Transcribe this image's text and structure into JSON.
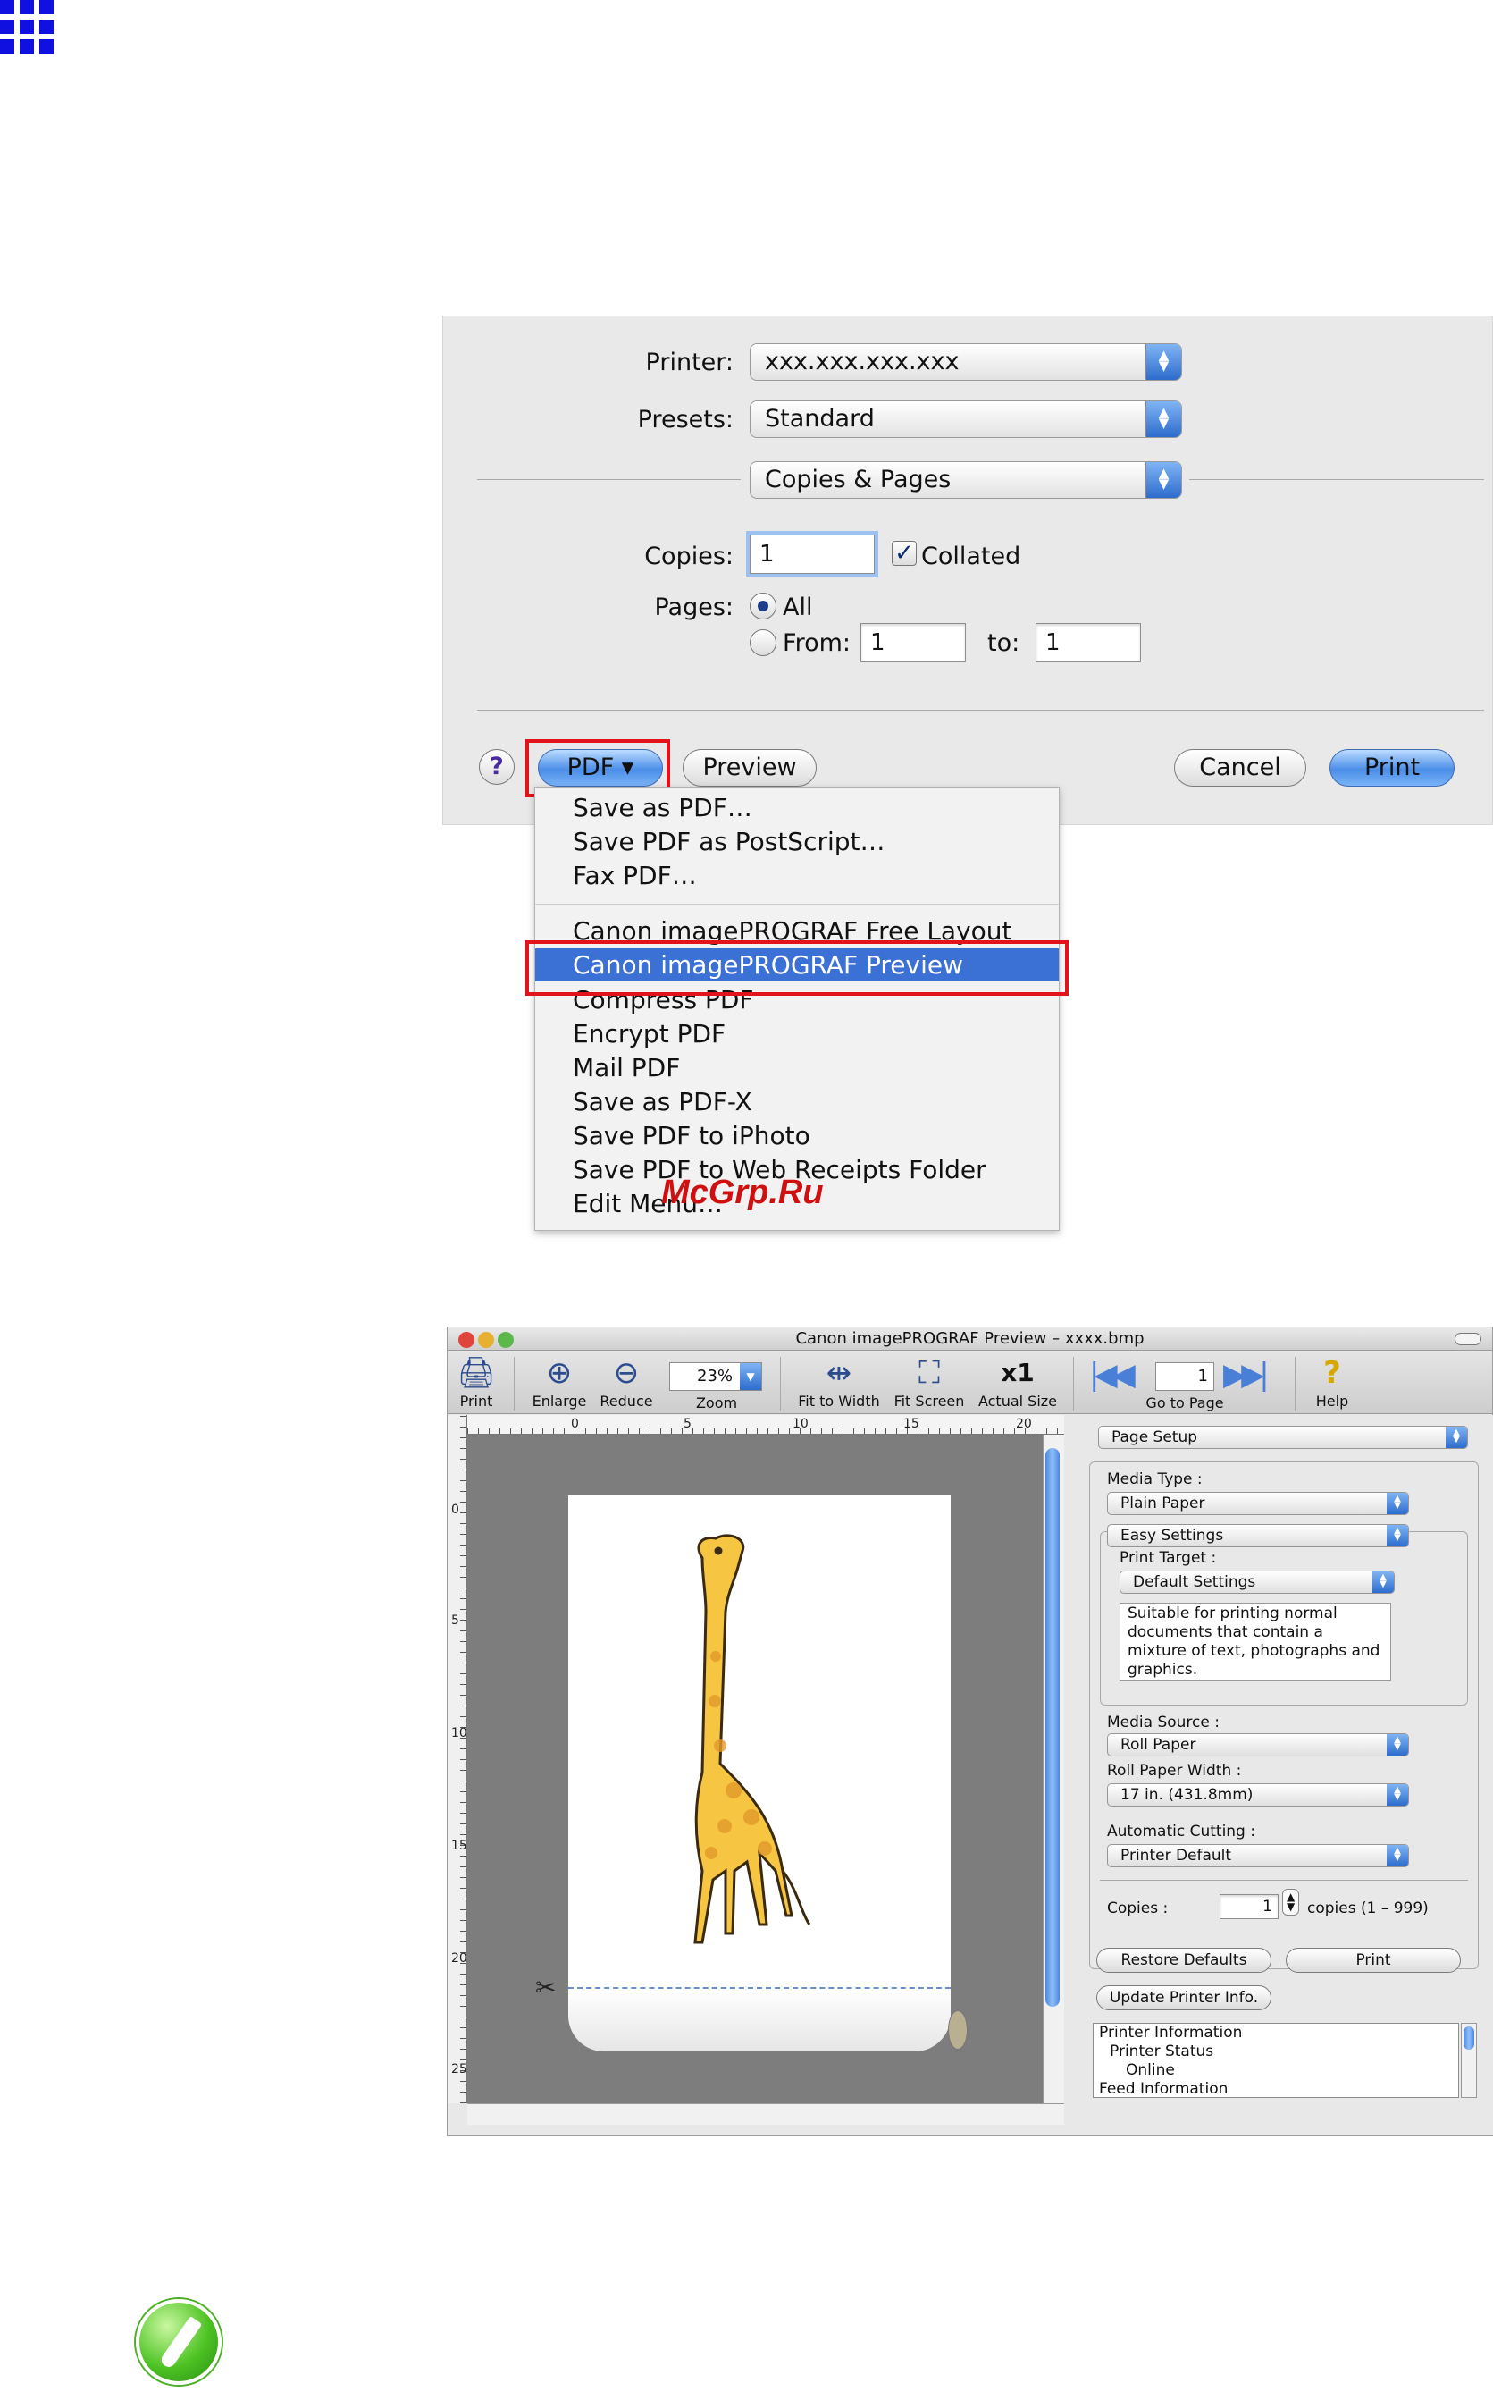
{
  "print_dialog": {
    "printer_label": "Printer:",
    "printer_value": "xxx.xxx.xxx.xxx",
    "presets_label": "Presets:",
    "presets_value": "Standard",
    "panel_value": "Copies & Pages",
    "copies_label": "Copies:",
    "copies_value": "1",
    "collated_label": "Collated",
    "collated_checked": true,
    "pages_label": "Pages:",
    "pages_all": "All",
    "pages_from": "From:",
    "pages_from_value": "1",
    "pages_to": "to:",
    "pages_to_value": "1",
    "help_label": "?",
    "pdf_label": "PDF ▾",
    "preview_label": "Preview",
    "cancel_label": "Cancel",
    "print_label": "Print"
  },
  "pdf_menu": {
    "items": [
      "Save as PDF…",
      "Save PDF as PostScript…",
      "Fax PDF…",
      "Canon imagePROGRAF Free Layout",
      "Canon imagePROGRAF Preview",
      "Compress PDF",
      "Encrypt PDF",
      "Mail PDF",
      "Save as PDF-X",
      "Save PDF to iPhoto",
      "Save PDF to Web Receipts Folder",
      "Edit Menu…"
    ],
    "selected": "Canon imagePROGRAF Preview"
  },
  "watermark": "McGrp.Ru",
  "preview_window": {
    "title": "Canon imagePROGRAF Preview – xxxx.bmp",
    "toolbar": {
      "print": "Print",
      "enlarge": "Enlarge",
      "reduce": "Reduce",
      "zoom_value": "23%",
      "zoom": "Zoom",
      "fit_width": "Fit to Width",
      "fit_screen": "Fit Screen",
      "actual_size": "Actual Size",
      "actual_size_icon": "x1",
      "page_value": "1",
      "go_to_page": "Go to Page",
      "help": "Help"
    },
    "ruler": {
      "h": [
        "0",
        "5",
        "10",
        "15",
        "20"
      ],
      "v": [
        "0",
        "5",
        "10",
        "15",
        "20",
        "25"
      ]
    },
    "panel": {
      "section": "Page Setup",
      "media_type_label": "Media Type :",
      "media_type_value": "Plain Paper",
      "easy_settings": "Easy Settings",
      "print_target_label": "Print Target :",
      "print_target_value": "Default Settings",
      "description_lines": [
        "Suitable for printing normal",
        "documents that contain a",
        "mixture of text, photographs and",
        "graphics."
      ],
      "media_source_label": "Media Source :",
      "media_source_value": "Roll Paper",
      "roll_width_label": "Roll Paper Width :",
      "roll_width_value": "17 in. (431.8mm)",
      "auto_cut_label": "Automatic Cutting :",
      "auto_cut_value": "Printer Default",
      "copies_label": "Copies :",
      "copies_value": "1",
      "copies_range": "copies (1 – 999)",
      "restore_defaults": "Restore Defaults",
      "print": "Print",
      "update_info": "Update Printer Info.",
      "info_list": [
        "Printer Information",
        "Printer Status",
        "Online",
        "Feed Information"
      ]
    }
  },
  "colors": {
    "highlight_red": "#e3131b",
    "menu_selection": "#3b70d4",
    "grid_icon_blue": "#1010e0"
  }
}
